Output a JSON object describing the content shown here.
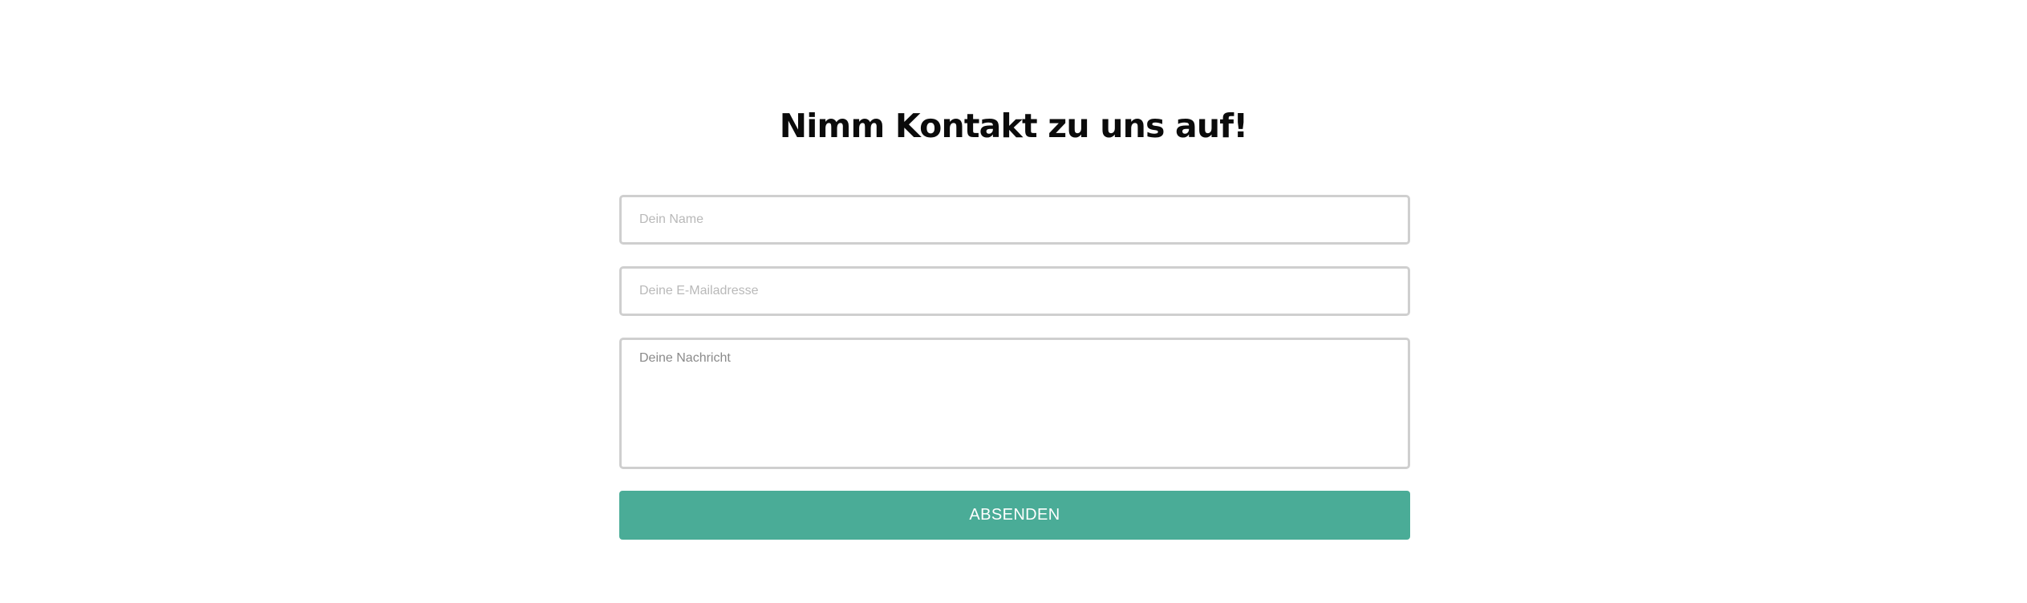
{
  "contact": {
    "title": "Nimm Kontakt zu uns auf!",
    "name_placeholder": "Dein Name",
    "email_placeholder": "Deine E-Mailadresse",
    "message_placeholder": "Deine Nachricht",
    "submit_label": "ABSENDEN"
  },
  "colors": {
    "title": "#0b0b0b",
    "field_border": "#cfcfcf",
    "placeholder": "#b9b9b9",
    "button_background": "#4aac97",
    "button_text": "#ffffff",
    "page_background": "#ffffff"
  }
}
